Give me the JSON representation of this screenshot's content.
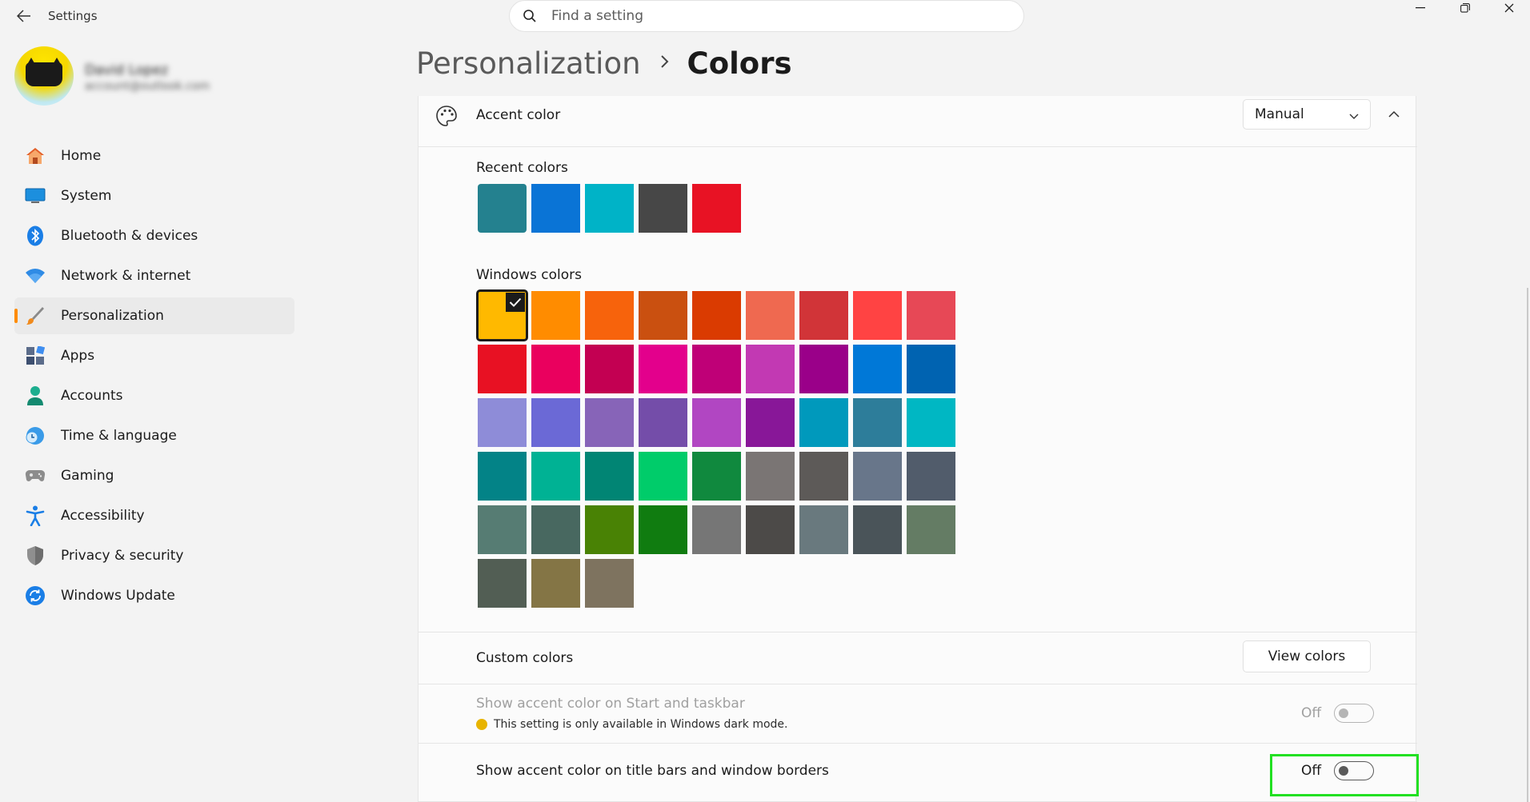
{
  "titlebar": {
    "app_title": "Settings",
    "search_placeholder": "Find a setting"
  },
  "profile": {
    "name": "David Lopez",
    "email": "account@outlook.com"
  },
  "nav": [
    {
      "id": "home",
      "label": "Home",
      "icon": "home-icon"
    },
    {
      "id": "system",
      "label": "System",
      "icon": "system-icon"
    },
    {
      "id": "bluetooth",
      "label": "Bluetooth & devices",
      "icon": "bluetooth-icon"
    },
    {
      "id": "network",
      "label": "Network & internet",
      "icon": "wifi-icon"
    },
    {
      "id": "personalization",
      "label": "Personalization",
      "icon": "brush-icon",
      "active": true
    },
    {
      "id": "apps",
      "label": "Apps",
      "icon": "apps-icon"
    },
    {
      "id": "accounts",
      "label": "Accounts",
      "icon": "person-icon"
    },
    {
      "id": "time",
      "label": "Time & language",
      "icon": "globe-clock-icon"
    },
    {
      "id": "gaming",
      "label": "Gaming",
      "icon": "gamepad-icon"
    },
    {
      "id": "accessibility",
      "label": "Accessibility",
      "icon": "accessibility-icon"
    },
    {
      "id": "privacy",
      "label": "Privacy & security",
      "icon": "shield-icon"
    },
    {
      "id": "update",
      "label": "Windows Update",
      "icon": "update-icon"
    }
  ],
  "breadcrumb": {
    "parent": "Personalization",
    "current": "Colors"
  },
  "accent": {
    "label": "Accent color",
    "mode": "Manual",
    "recent_label": "Recent colors",
    "recent_colors": [
      "#24818f",
      "#0a74d6",
      "#00b3c7",
      "#474747",
      "#e81224"
    ],
    "windows_label": "Windows colors",
    "windows_colors": [
      "#ffb900",
      "#ff8c00",
      "#f7630c",
      "#ca5010",
      "#da3b01",
      "#ef6950",
      "#d13438",
      "#ff4343",
      "#e74856",
      "#e81123",
      "#ea005e",
      "#c30052",
      "#e3008c",
      "#bf0077",
      "#c239b3",
      "#9a0089",
      "#0078d7",
      "#0063b1",
      "#8e8cd8",
      "#6b69d6",
      "#8764b8",
      "#744da9",
      "#b146c2",
      "#881798",
      "#0099bc",
      "#2d7d9a",
      "#00b7c3",
      "#038387",
      "#00b294",
      "#018574",
      "#00cc6a",
      "#10893e",
      "#7a7574",
      "#5d5a58",
      "#68768a",
      "#515c6b",
      "#567c73",
      "#486860",
      "#498205",
      "#107c10",
      "#767676",
      "#4c4a48",
      "#69797e",
      "#4a5459",
      "#647c64",
      "#525e54",
      "#847545",
      "#7e735f"
    ],
    "selected_index": 0
  },
  "custom_colors": {
    "label": "Custom colors",
    "button": "View colors"
  },
  "start_taskbar": {
    "label": "Show accent color on Start and taskbar",
    "note": "This setting is only available in Windows dark mode.",
    "state": "Off"
  },
  "title_bars": {
    "label": "Show accent color on title bars and window borders",
    "state": "Off"
  }
}
